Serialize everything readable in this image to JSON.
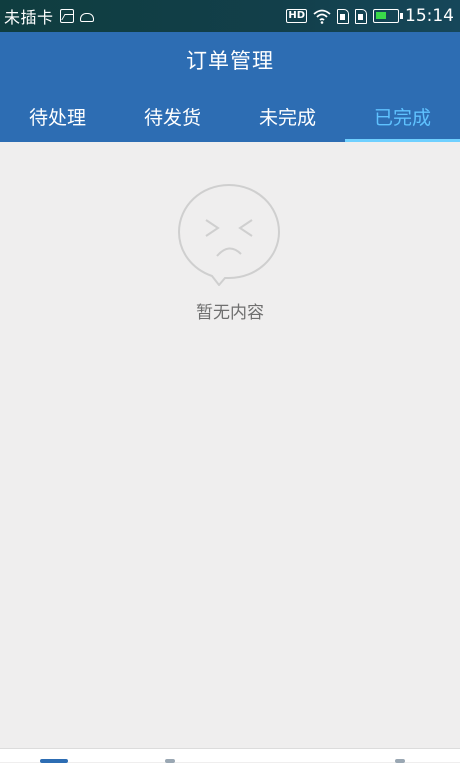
{
  "status_bar": {
    "sim_text": "未插卡",
    "time": "15:14",
    "icons": [
      "photo-icon",
      "cloud-icon",
      "hd-icon",
      "wifi-icon",
      "sim-icon",
      "sim-icon",
      "battery-icon"
    ],
    "battery_color": "#3ad94a"
  },
  "header": {
    "title": "订单管理",
    "bg_color": "#2d6db3"
  },
  "tabs": [
    {
      "label": "待处理",
      "active": false
    },
    {
      "label": "待发货",
      "active": false
    },
    {
      "label": "未完成",
      "active": false
    },
    {
      "label": "已完成",
      "active": true
    }
  ],
  "empty_state": {
    "icon": "sad-face-bubble-icon",
    "text": "暂无内容"
  },
  "colors": {
    "active_tab": "#5fc2ff",
    "background": "#efeeee"
  }
}
